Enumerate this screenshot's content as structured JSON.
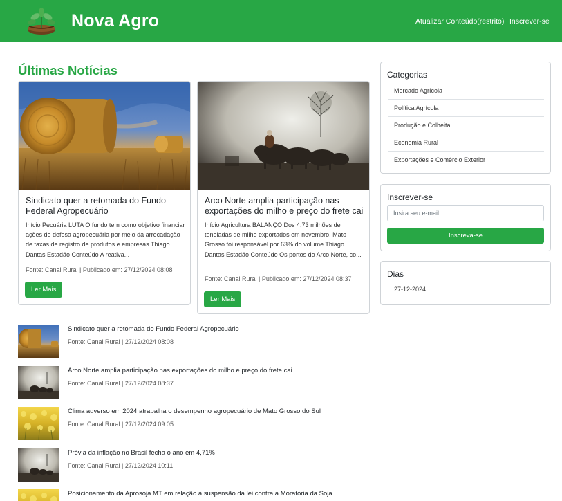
{
  "navbar": {
    "brand": "Nova Agro",
    "links": [
      "Atualizar Conteúdo(restrito)",
      "Inscrever-se"
    ],
    "color": "#28a745"
  },
  "main": {
    "section_title": "Últimas Notícias",
    "cards": [
      {
        "title": "Sindicato quer a retomada do Fundo Federal Agropecuário",
        "text": "Início Pecuária LUTA O fundo tem como objetivo financiar ações de defesa agropecuária por meio da arrecadação de taxas de registro de produtos e empresas Thiago Dantas Estadão Conteúdo A reativa...",
        "meta": "Fonte: Canal Rural | Publicado em: 27/12/2024 08:08",
        "button": "Ler Mais",
        "image": "hay-bales-field"
      },
      {
        "title": "Arco Norte amplia participação nas exportações do milho e preço do frete cai",
        "text": "Início Agricultura BALANÇO Dos 4,73 milhões de toneladas de milho exportados em novembro, Mato Grosso foi responsável por 63% do volume Thiago Dantas Estadão Conteúdo Os portos do Arco Norte, co...",
        "meta": "Fonte: Canal Rural | Publicado em: 27/12/2024 08:37",
        "button": "Ler Mais",
        "image": "buffalo-herd-mist"
      }
    ],
    "news_list": [
      {
        "title": "Sindicato quer a retomada do Fundo Federal Agropecuário",
        "meta": "Fonte: Canal Rural | 27/12/2024 08:08",
        "image": "hay"
      },
      {
        "title": "Arco Norte amplia participação nas exportações do milho e preço do frete cai",
        "meta": "Fonte: Canal Rural | 27/12/2024 08:37",
        "image": "buffalo"
      },
      {
        "title": "Clima adverso em 2024 atrapalha o desempenho agropecuário de Mato Grosso do Sul",
        "meta": "Fonte: Canal Rural | 27/12/2024 09:05",
        "image": "crops"
      },
      {
        "title": "Prévia da inflação no Brasil fecha o ano em 4,71%",
        "meta": "Fonte: Canal Rural | 27/12/2024 10:11",
        "image": "buffalo"
      },
      {
        "title": "Posicionamento da Aprosoja MT em relação à suspensão da lei contra a Moratória da Soja",
        "meta": "",
        "image": "crops"
      }
    ]
  },
  "sidebar": {
    "categories": {
      "title": "Categorias",
      "items": [
        "Mercado Agrícola",
        "Política Agrícola",
        "Produção e Colheita",
        "Economia Rural",
        "Exportações e Comércio Exterior"
      ]
    },
    "subscribe": {
      "title": "Inscrever-se",
      "placeholder": "Insira seu e-mail",
      "button": "Inscreva-se"
    },
    "days": {
      "title": "Dias",
      "items": [
        "27-12-2024"
      ]
    }
  }
}
